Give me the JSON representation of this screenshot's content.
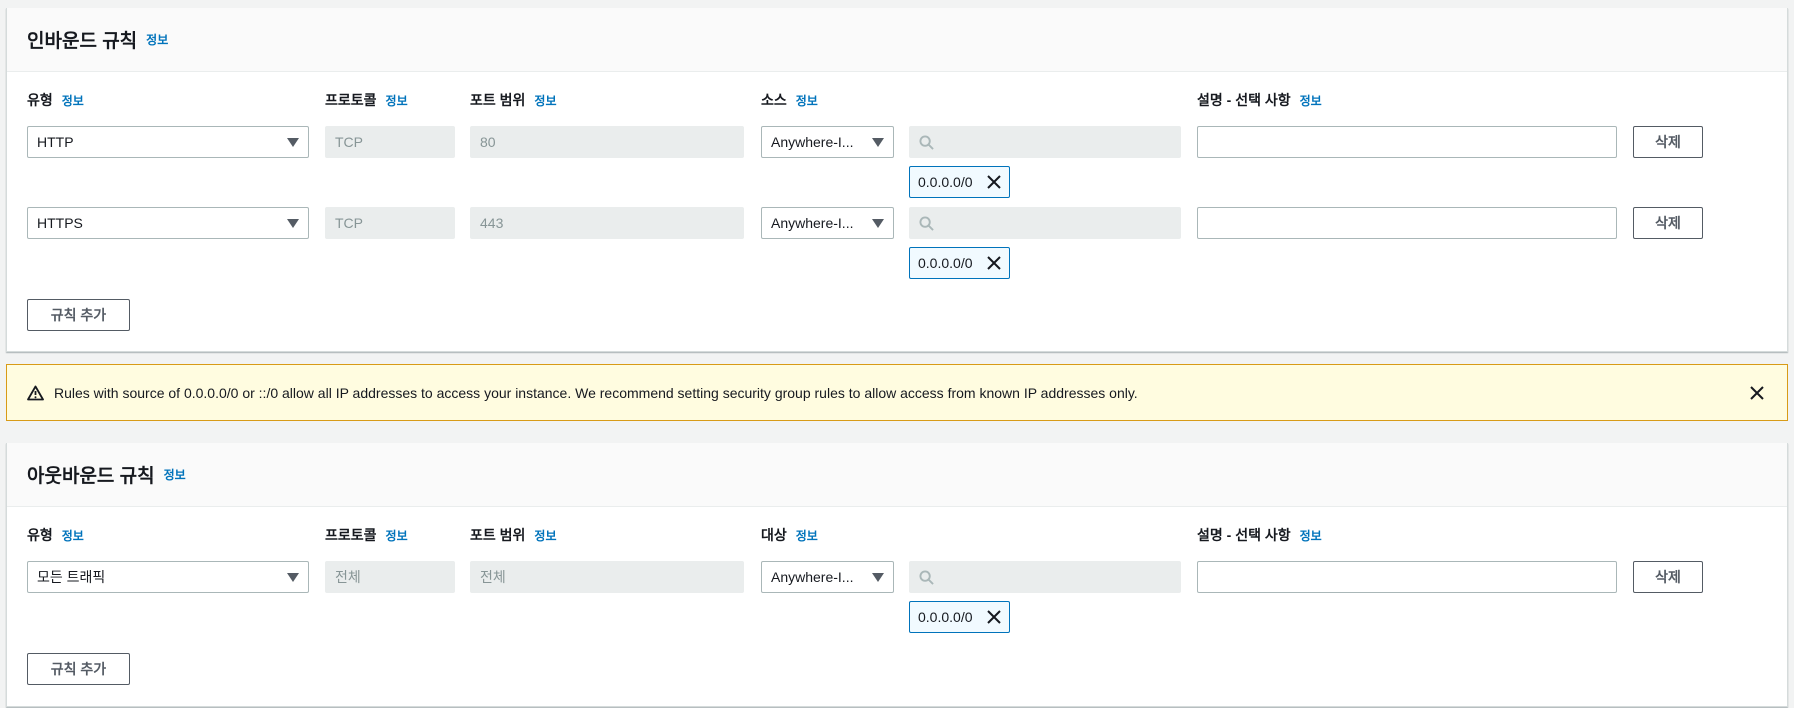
{
  "inbound": {
    "title": "인바운드 규칙",
    "info": "정보",
    "columns": {
      "type": "유형",
      "protocol": "프로토콜",
      "port_range": "포트 범위",
      "source": "소스",
      "description": "설명 - 선택 사항",
      "info": "정보"
    },
    "rules": [
      {
        "type": "HTTP",
        "protocol": "TCP",
        "port": "80",
        "source": "Anywhere-I...",
        "cidr": "0.0.0.0/0",
        "delete": "삭제"
      },
      {
        "type": "HTTPS",
        "protocol": "TCP",
        "port": "443",
        "source": "Anywhere-I...",
        "cidr": "0.0.0.0/0",
        "delete": "삭제"
      }
    ],
    "add_rule": "규칙 추가"
  },
  "alert": {
    "message": "Rules with source of 0.0.0.0/0 or ::/0 allow all IP addresses to access your instance. We recommend setting security group rules to allow access from known IP addresses only.",
    "icon": "warning-icon"
  },
  "outbound": {
    "title": "아웃바운드 규칙",
    "info": "정보",
    "columns": {
      "type": "유형",
      "protocol": "프로토콜",
      "port_range": "포트 범위",
      "destination": "대상",
      "description": "설명 - 선택 사항",
      "info": "정보"
    },
    "rules": [
      {
        "type": "모든 트래픽",
        "protocol": "전체",
        "port": "전체",
        "destination": "Anywhere-I...",
        "cidr": "0.0.0.0/0",
        "delete": "삭제"
      }
    ],
    "add_rule": "규칙 추가"
  },
  "colors": {
    "link": "#0073bb",
    "alert_bg": "#fffce0",
    "alert_border": "#d89b17",
    "token_border": "#0073bb"
  }
}
